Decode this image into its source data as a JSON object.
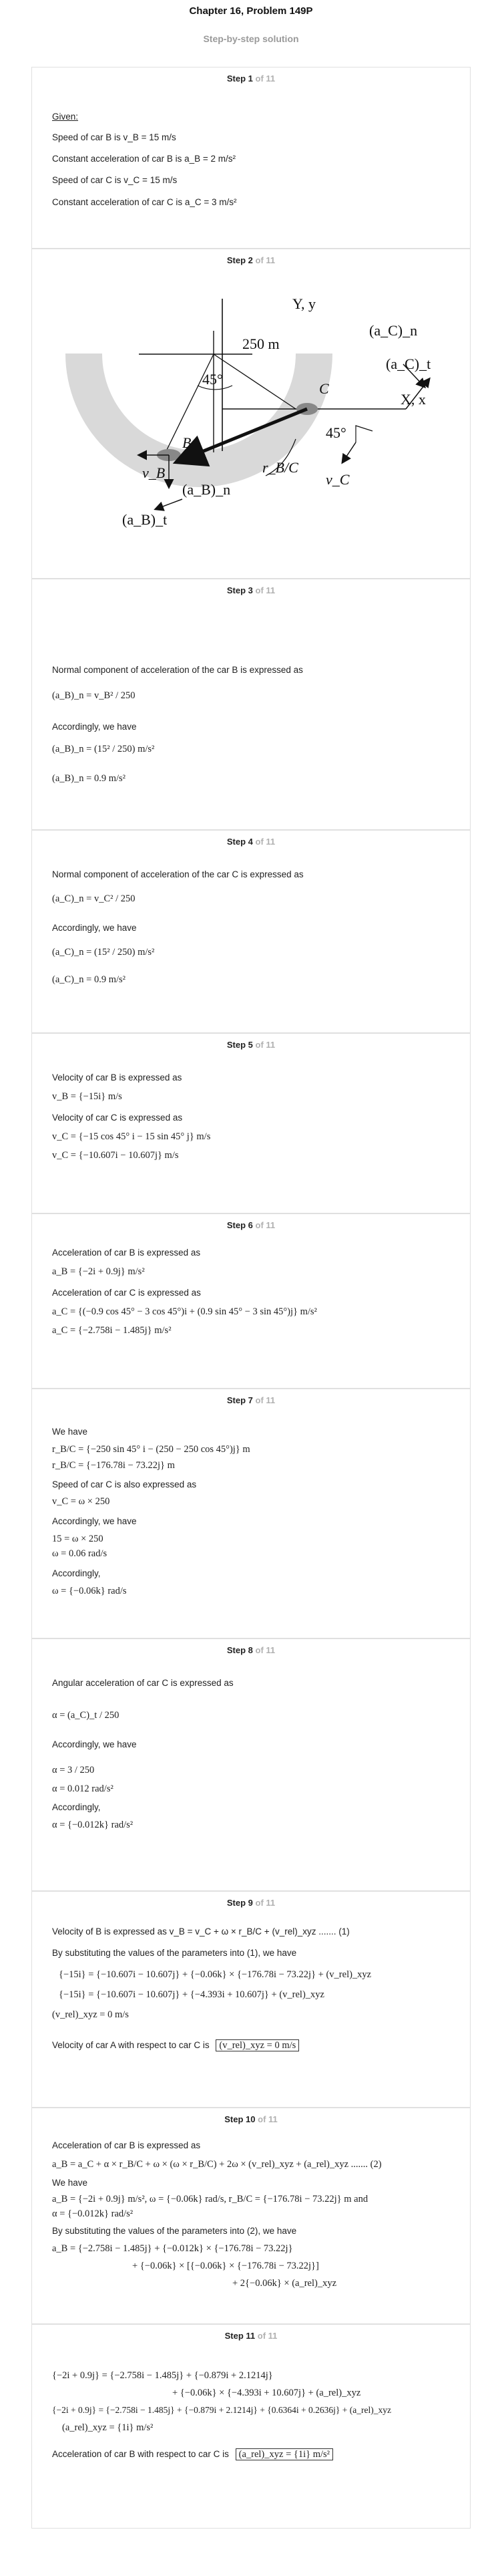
{
  "header": {
    "title": "Chapter 16, Problem 149P",
    "subtitle": "Step-by-step solution"
  },
  "steps": [
    {
      "label": "Step 1",
      "total": "of 11"
    },
    {
      "label": "Step 2",
      "total": "of 11"
    },
    {
      "label": "Step 3",
      "total": "of 11"
    },
    {
      "label": "Step 4",
      "total": "of 11"
    },
    {
      "label": "Step 5",
      "total": "of 11"
    },
    {
      "label": "Step 6",
      "total": "of 11"
    },
    {
      "label": "Step 7",
      "total": "of 11"
    },
    {
      "label": "Step 8",
      "total": "of 11"
    },
    {
      "label": "Step 9",
      "total": "of 11"
    },
    {
      "label": "Step 10",
      "total": "of 11"
    },
    {
      "label": "Step 11",
      "total": "of 11"
    }
  ],
  "step1": {
    "given": "Given:",
    "l1": "Speed of car  B is  v_B = 15 m/s",
    "l2": "Constant acceleration of car  B is  a_B = 2 m/s²",
    "l3": "Speed of car  C is  v_C = 15 m/s",
    "l4": "Constant acceleration of car  C is  a_C = 3 m/s²"
  },
  "step2": {
    "lbl_Y": "Y, y",
    "lbl_X": "X, x",
    "lbl_acn": "(a_C)_n",
    "lbl_act": "(a_C)_t",
    "lbl_250": "250 m",
    "lbl_45a": "45°",
    "lbl_45b": "45°",
    "lbl_B": "B",
    "lbl_C": "C",
    "lbl_vB": "v_B",
    "lbl_rBC": "r_B/C",
    "lbl_vC": "v_C",
    "lbl_abn": "(a_B)_n",
    "lbl_abt": "(a_B)_t"
  },
  "step3": {
    "l1": "Normal component of acceleration of the car  B is expressed as",
    "f1": "(a_B)_n = v_B² / 250",
    "l2": "Accordingly, we have",
    "f2": "(a_B)_n = (15² / 250) m/s²",
    "f3": "(a_B)_n = 0.9 m/s²"
  },
  "step4": {
    "l1": "Normal component of acceleration of the car  C is expressed as",
    "f1": "(a_C)_n = v_C² / 250",
    "l2": "Accordingly, we have",
    "f2": "(a_C)_n = (15² / 250) m/s²",
    "f3": "(a_C)_n = 0.9 m/s²"
  },
  "step5": {
    "l1": "Velocity of car  B is expressed as",
    "f1": "v_B = {−15i} m/s",
    "l2": "Velocity of car  C is expressed as",
    "f2": "v_C = {−15 cos 45° i − 15 sin 45° j} m/s",
    "f3": "v_C = {−10.607i − 10.607j} m/s"
  },
  "step6": {
    "l1": "Acceleration of car  B is expressed as",
    "f1": "a_B = {−2i + 0.9j} m/s²",
    "l2": "Acceleration of car  C is expressed as",
    "f2": "a_C = {(−0.9 cos 45° − 3 cos 45°)i + (0.9 sin 45° − 3 sin 45°)j} m/s²",
    "f3": "a_C = {−2.758i − 1.485j} m/s²"
  },
  "step7": {
    "l1": "We have",
    "f1": "r_B/C = {−250 sin 45° i − (250 − 250 cos 45°)j} m",
    "f2": "r_B/C = {−176.78i − 73.22j} m",
    "l2": "Speed of car  C is also expressed as",
    "f3": "v_C = ω × 250",
    "l3": "Accordingly, we have",
    "f4": "15 = ω × 250",
    "f5": "ω = 0.06 rad/s",
    "l4": "Accordingly,",
    "f6": "ω = {−0.06k} rad/s"
  },
  "step8": {
    "l1": "Angular acceleration of car  C is expressed as",
    "f1": "α = (a_C)_t / 250",
    "l2": "Accordingly, we have",
    "f2": "α = 3 / 250",
    "f3": "α = 0.012 rad/s²",
    "l3": "Accordingly,",
    "f4": "α = {−0.012k} rad/s²"
  },
  "step9": {
    "l1": "Velocity of  B is expressed as  v_B = v_C + ω × r_B/C + (v_rel)_xyz ....... (1)",
    "l2": "By substituting the values of the parameters into (1), we have",
    "f1": "{−15i} = {−10.607i − 10.607j} + {−0.06k} × {−176.78i − 73.22j} + (v_rel)_xyz",
    "f2": "{−15i} = {−10.607i − 10.607j} + {−4.393i + 10.607j} + (v_rel)_xyz",
    "f3": "(v_rel)_xyz = 0 m/s",
    "l3": "Velocity of car  A with respect to car  C is",
    "ans": "(v_rel)_xyz = 0 m/s"
  },
  "step10": {
    "l1": "Acceleration of car  B is expressed as",
    "f1": "a_B = a_C + α × r_B/C + ω × (ω × r_B/C) + 2ω × (v_rel)_xyz + (a_rel)_xyz ....... (2)",
    "l2": "We have",
    "f2": "a_B = {−2i + 0.9j} m/s²,  ω = {−0.06k} rad/s,  r_B/C = {−176.78i − 73.22j} m and",
    "f3": "α = {−0.012k} rad/s²",
    "l3": "By substituting the values of the parameters into (2), we have",
    "f4": "a_B = {−2.758i − 1.485j} + {−0.012k} × {−176.78i − 73.22j}",
    "f5": "+ {−0.06k} × [{−0.06k} × {−176.78i − 73.22j}]",
    "f6": "+ 2{−0.06k} × (a_rel)_xyz"
  },
  "step11": {
    "f1": "{−2i + 0.9j} = {−2.758i − 1.485j} + {−0.879i + 2.1214j}",
    "f2": "+ {−0.06k} × {−4.393i + 10.607j} + (a_rel)_xyz",
    "f3": "{−2i + 0.9j} = {−2.758i − 1.485j} + {−0.879i + 2.1214j} + {0.6364i + 0.2636j} + (a_rel)_xyz",
    "f4": "(a_rel)_xyz = {1i} m/s²",
    "l1": "Acceleration of car  B with respect to car  C is",
    "ans": "(a_rel)_xyz = {1i} m/s²"
  },
  "colors": {
    "arc": "#d9d9d9",
    "car": "#888888",
    "muted": "#b0b0b0"
  }
}
